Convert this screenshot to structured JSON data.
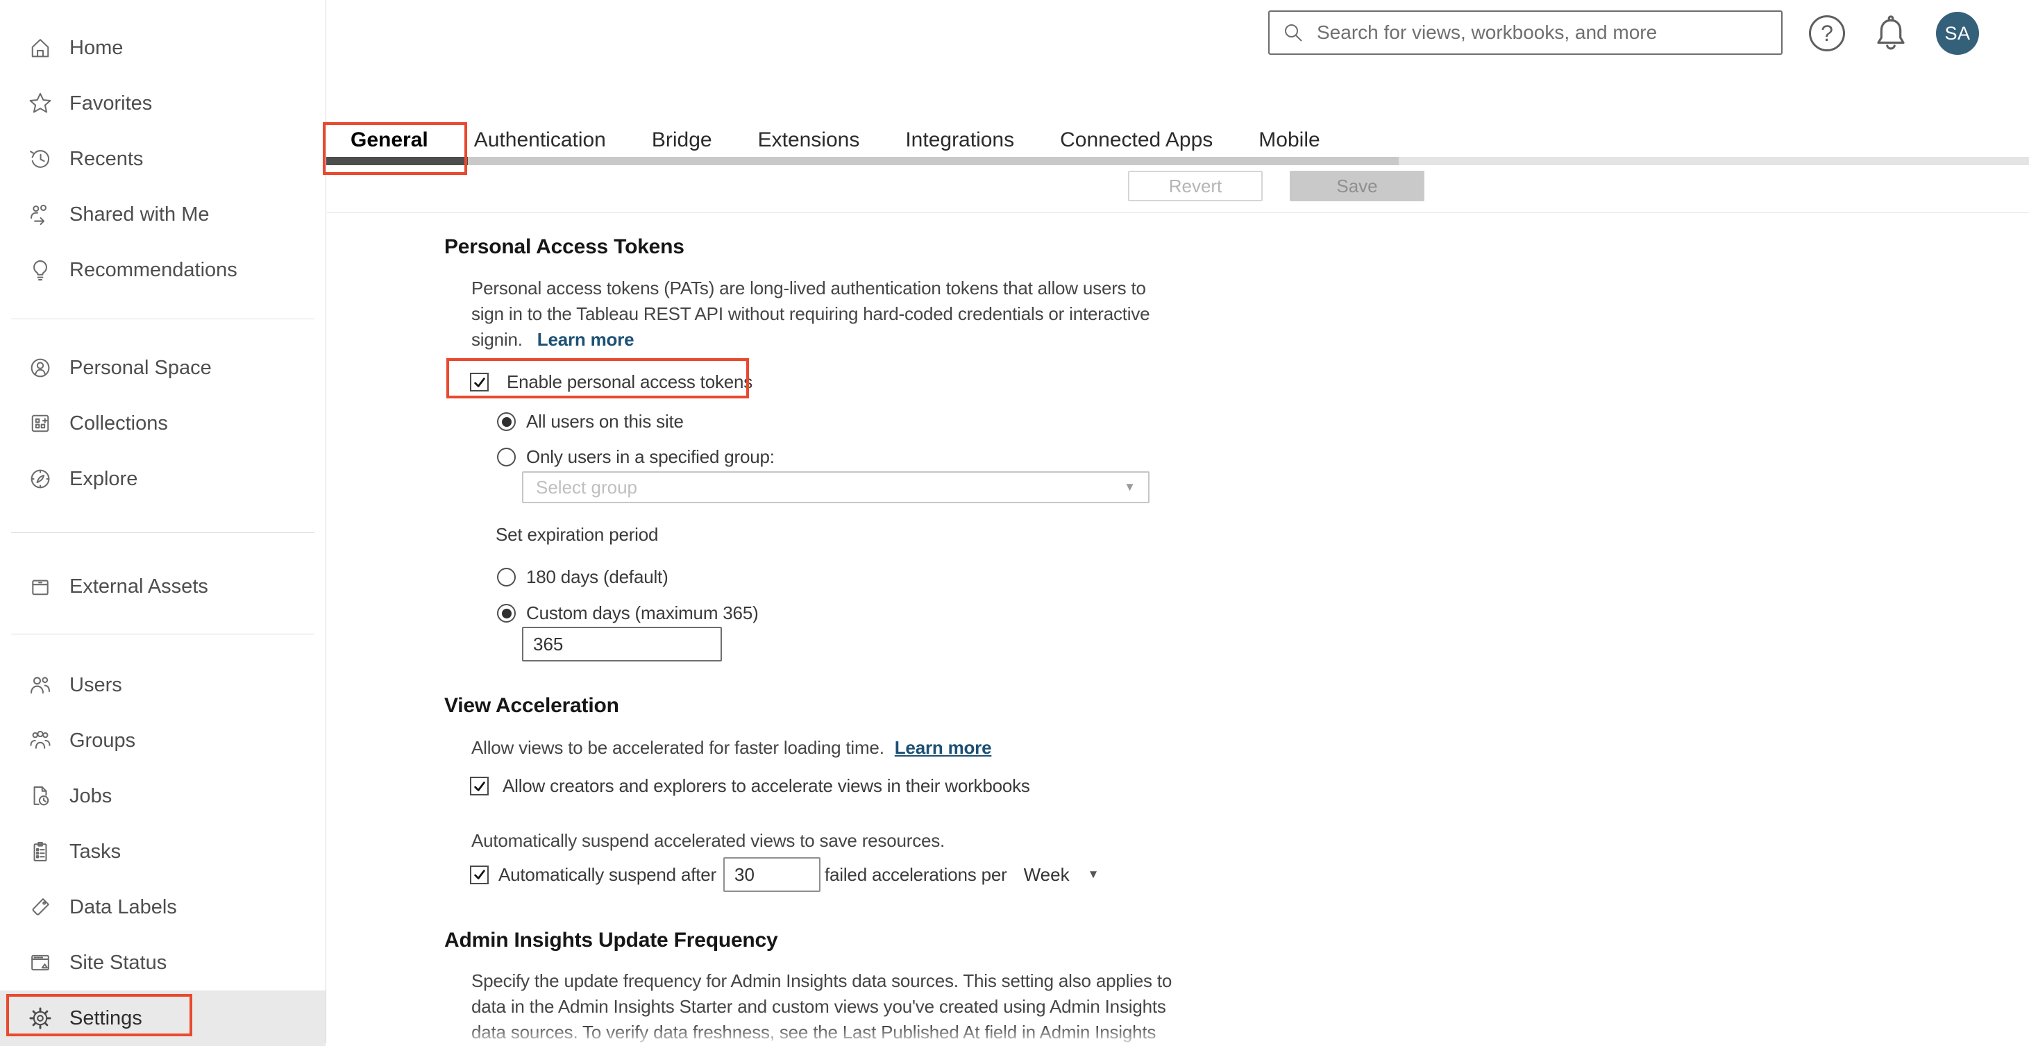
{
  "topbar": {
    "search_placeholder": "Search for views, workbooks, and more",
    "avatar_initials": "SA"
  },
  "icons": {
    "help_glyph": "?",
    "caret_down": "▼"
  },
  "sidebar": {
    "groups": [
      {
        "items": [
          {
            "label": "Home"
          },
          {
            "label": "Favorites"
          },
          {
            "label": "Recents"
          },
          {
            "label": "Shared with Me"
          },
          {
            "label": "Recommendations"
          }
        ]
      },
      {
        "items": [
          {
            "label": "Personal Space"
          },
          {
            "label": "Collections"
          },
          {
            "label": "Explore"
          }
        ]
      },
      {
        "items": [
          {
            "label": "External Assets"
          }
        ]
      },
      {
        "items": [
          {
            "label": "Users"
          },
          {
            "label": "Groups"
          },
          {
            "label": "Jobs"
          },
          {
            "label": "Tasks"
          },
          {
            "label": "Data Labels"
          },
          {
            "label": "Site Status"
          },
          {
            "label": "Settings"
          }
        ]
      }
    ],
    "active_item": "Settings"
  },
  "tabs": {
    "items": [
      {
        "label": "General"
      },
      {
        "label": "Authentication"
      },
      {
        "label": "Bridge"
      },
      {
        "label": "Extensions"
      },
      {
        "label": "Integrations"
      },
      {
        "label": "Connected Apps"
      },
      {
        "label": "Mobile"
      }
    ],
    "selected": "General"
  },
  "toolbar": {
    "revert_label": "Revert",
    "save_label": "Save"
  },
  "sections": {
    "pat": {
      "title": "Personal Access Tokens",
      "description_lines": [
        "Personal access tokens (PATs) are long-lived authentication tokens that allow users to",
        "sign in to the Tableau REST API without requiring hard-coded credentials or interactive"
      ],
      "description_last_line": "signin.",
      "learn_more": "Learn more",
      "enable_label": "Enable personal access tokens",
      "radio_all_users": "All users on this site",
      "radio_specified_group": "Only users in a specified group:",
      "group_select_placeholder": "Select group",
      "expiration_label": "Set expiration period",
      "radio_180_days": "180 days (default)",
      "radio_custom_days": "Custom days (maximum 365)",
      "custom_days_value": "365"
    },
    "view_acceleration": {
      "title": "View Acceleration",
      "description": "Allow views to be accelerated for faster loading time.",
      "learn_more": "Learn more",
      "allow_label": "Allow creators and explorers to accelerate views in their workbooks",
      "suspend_description": "Automatically suspend accelerated views to save resources.",
      "suspend_prefix": "Automatically suspend after",
      "suspend_value": "30",
      "suspend_suffix": "failed accelerations per",
      "period_value": "Week"
    },
    "admin_insights": {
      "title": "Admin Insights Update Frequency",
      "description_lines": [
        "Specify the update frequency for Admin Insights data sources. This setting also applies to",
        "data in the Admin Insights Starter and custom views you've created using Admin Insights",
        "data sources. To verify data freshness, see the Last Published At field in Admin Insights"
      ]
    }
  },
  "colors": {
    "annotation_red": "#e8492f",
    "avatar_bg": "#35607a",
    "link_blue": "#1c5074",
    "tab_active_underline": "#4d4d4d"
  }
}
